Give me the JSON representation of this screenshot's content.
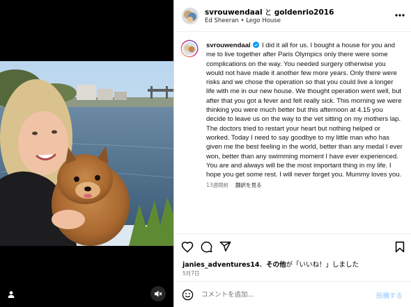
{
  "header": {
    "user1": "svrouwendaal",
    "connector": " と ",
    "user2": "goldenrio2016",
    "audio": "Ed Sheeran • Lego House",
    "more_icon": "more-horizontal-icon"
  },
  "caption": {
    "username": "svrouwendaal",
    "verified_icon": "verified-badge-icon",
    "text": "I did it all for us. I bought a house for you and me to live together after Paris Olympics only there were some complications on the way. You needed surgery otherwise you would not have made it another few more years. Only there were risks and we chose the operation so that you could live a longer life with me in our new house. We thought operation went well, but after that you got a fever and felt really sick. This morning we were thinking you were much better but this afternoon at 4.15 you decide to leave us on the way to the vet sitting on my mothers lap. The doctors tried to restart your heart but nothing helped or worked. Today I need to say goodbye to my little man who has given me the best feeling in the world, better than any medal I ever won, better than any swimming moment I have ever experienced. You are and always will be the most important thing in my life. I hope you get some rest. I will never forget you. Mummy loves you.",
    "time_ago": "13週間前",
    "translate": "翻訳を見る"
  },
  "actions": {
    "like_icon": "heart-icon",
    "comment_icon": "comment-icon",
    "share_icon": "share-icon",
    "save_icon": "bookmark-icon"
  },
  "likes": {
    "user": "janies_adventures14",
    "middle": "、",
    "others": "その他",
    "rest": "が「いいね！」しました"
  },
  "date": "5月7日",
  "comment": {
    "placeholder": "コメントを追加...",
    "post_label": "投稿する",
    "emoji_icon": "smiley-icon"
  },
  "media": {
    "user_icon": "user-tag-icon",
    "mute_icon": "speaker-muted-icon"
  },
  "colors": {
    "verified": "#0095f6",
    "post_disabled": "#b3dbff",
    "meta_gray": "#737373"
  }
}
